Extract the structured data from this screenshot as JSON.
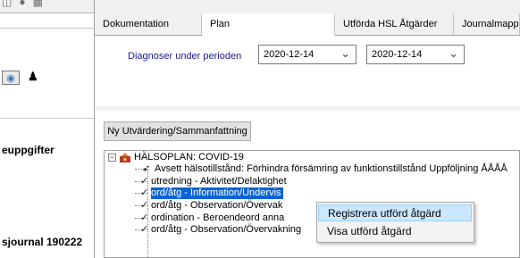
{
  "left": {
    "partial_texts": [
      "euppgifter",
      "sjournal 190222"
    ]
  },
  "tabs": [
    {
      "label": "Dokumentation",
      "active": false
    },
    {
      "label": "Plan",
      "active": true
    },
    {
      "label": "Utförda HSL Åtgärder",
      "active": false
    },
    {
      "label": "Journalmapp",
      "active": false
    }
  ],
  "plan": {
    "period_label": "Diagnoser under perioden",
    "date_from": "2020-12-14",
    "date_to": "2020-12-14",
    "ny_button": "Ny Utvärdering/Sammanfattning"
  },
  "tree": {
    "root": "HÄLSOPLAN: COVID-19",
    "children": [
      "Avsett hälsotillstånd: Förhindra försämring av funktionstillstånd  Uppföljning ÅÅÅÅ",
      "utredning - Aktivitet/Delaktighet",
      "ord/åtg - Information/Undervis",
      "ord/åtg - Observation/Övervak",
      "ordination - Beroendeord anna",
      "ord/åtg - Observation/Övervakning"
    ]
  },
  "context_menu": {
    "items": [
      "Registrera utförd åtgärd",
      "Visa utförd åtgärd"
    ]
  },
  "colors": {
    "selection": "#0a64d6",
    "menu_highlight": "#cce8ff",
    "label_blue": "#1a1a8c"
  }
}
